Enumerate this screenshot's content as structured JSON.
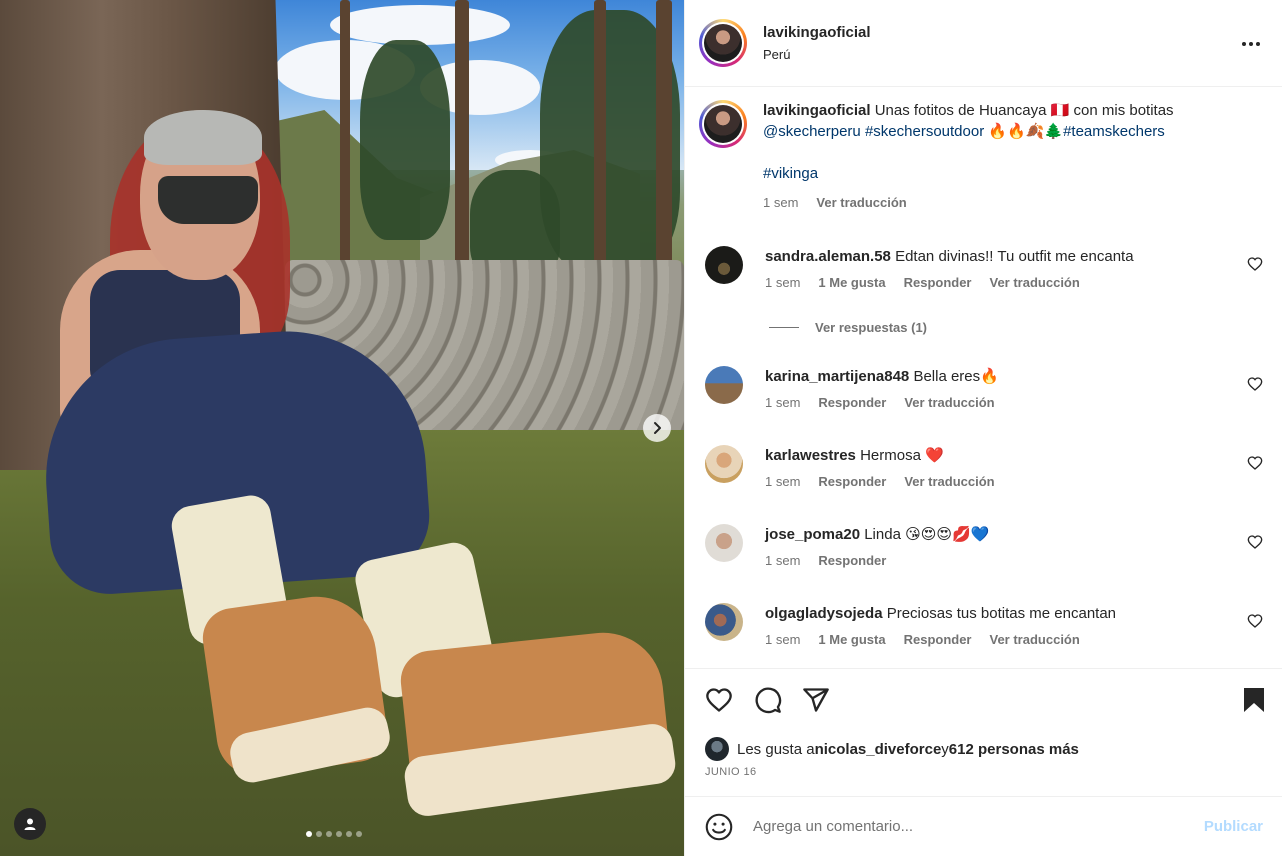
{
  "post": {
    "username": "lavikingaoficial",
    "location": "Perú",
    "caption_user": "lavikingaoficial",
    "caption_text": " Unas fotitos de Huancaya ",
    "caption_flags": "🇵🇪",
    "caption_text2": " con mis botitas",
    "caption_mention": "@skecherperu",
    "caption_tag1": "#skechersoutdoor",
    "caption_emojis": " 🔥🔥🍂🌲",
    "caption_tag2": "#teamskechers",
    "caption_tag3": "#vikinga",
    "caption_time": "1 sem",
    "caption_translate": "Ver traducción"
  },
  "comments": [
    {
      "user": "sandra.aleman.58",
      "text": "Edtan divinas!! Tu outfit me encanta",
      "time": "1 sem",
      "likes": "1 Me gusta",
      "reply": "Responder",
      "translate": "Ver traducción"
    },
    {
      "user": "karina_martijena848",
      "text": "Bella eres🔥",
      "time": "1 sem",
      "reply": "Responder",
      "translate": "Ver traducción"
    },
    {
      "user": "karlawestres",
      "text": "Hermosa ❤️",
      "time": "1 sem",
      "reply": "Responder",
      "translate": "Ver traducción"
    },
    {
      "user": "jose_poma20",
      "text": "Linda 😘😍😍💋💙",
      "time": "1 sem",
      "reply": "Responder"
    },
    {
      "user": "olgagladysojeda",
      "text": "Preciosas tus botitas me encantan",
      "time": "1 sem",
      "likes": "1 Me gusta",
      "reply": "Responder",
      "translate": "Ver traducción"
    }
  ],
  "view_replies": "Ver respuestas (1)",
  "likes": {
    "prefix": "Les gusta a ",
    "user": "nicolas_diveforce",
    "mid": " y ",
    "count": "612 personas más"
  },
  "date": "JUNIO 16",
  "add_comment": {
    "placeholder": "Agrega un comentario...",
    "publish": "Publicar"
  },
  "icons": {
    "like": "heart-icon",
    "comment": "comment-icon",
    "share": "share-icon",
    "save": "bookmark-icon",
    "more": "more-icon",
    "emoji": "emoji-icon",
    "tag": "user-tag-icon",
    "next": "chevron-right-icon"
  },
  "carousel": {
    "total_slides": 6,
    "active_slide": 1
  },
  "colors": {
    "link": "#00376b",
    "muted": "#737373",
    "publish": "#b3dbff"
  }
}
